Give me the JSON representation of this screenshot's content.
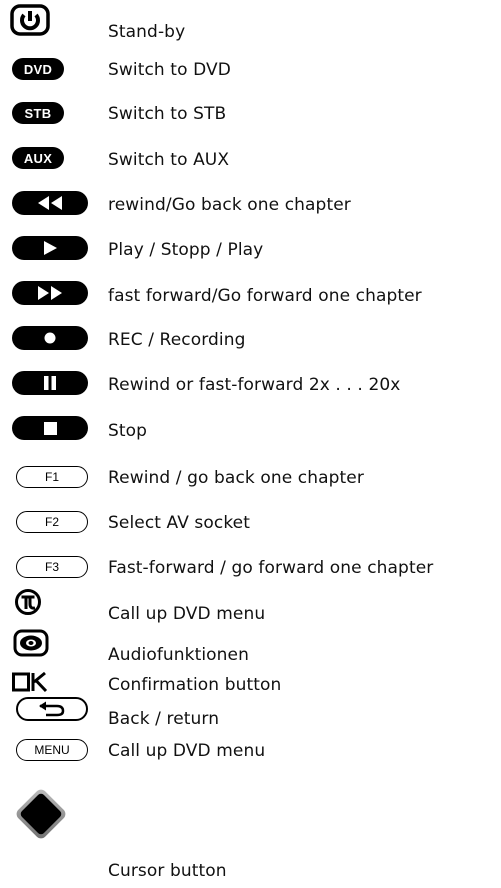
{
  "legend": [
    {
      "icon": "power-icon",
      "label": "Stand-by"
    },
    {
      "icon": "dvd-button-icon",
      "button_text": "DVD",
      "label": "Switch to DVD"
    },
    {
      "icon": "stb-button-icon",
      "button_text": "STB",
      "label": "Switch to STB"
    },
    {
      "icon": "aux-button-icon",
      "button_text": "AUX",
      "label": "Switch to AUX"
    },
    {
      "icon": "rewind-icon",
      "label": "rewind/Go back one chapter"
    },
    {
      "icon": "play-icon",
      "label": "Play / Stopp / Play"
    },
    {
      "icon": "fast-forward-icon",
      "label": "fast forward/Go forward one chapter"
    },
    {
      "icon": "record-icon",
      "label": "REC / Recording"
    },
    {
      "icon": "pause-icon",
      "label": "Rewind or fast-forward 2x . . . 20x"
    },
    {
      "icon": "stop-icon",
      "label": "Stop"
    },
    {
      "icon": "f1-button-icon",
      "button_text": "F1",
      "label": "Rewind / go back one chapter"
    },
    {
      "icon": "f2-button-icon",
      "button_text": "F2",
      "label": "Select AV socket"
    },
    {
      "icon": "f3-button-icon",
      "button_text": "F3",
      "label": "Fast-forward / go forward one chapter"
    },
    {
      "icon": "dvd-menu-logo-icon",
      "label": "Call up DVD menu"
    },
    {
      "icon": "audio-icon",
      "label": "Audiofunktionen"
    },
    {
      "icon": "ok-icon",
      "button_text": "OK",
      "label": "Confirmation button"
    },
    {
      "icon": "back-return-icon",
      "label": "Back / return"
    },
    {
      "icon": "menu-button-icon",
      "button_text": "MENU",
      "label": "Call up DVD menu"
    },
    {
      "icon": "cursor-diamond-icon",
      "label": "Cursor button"
    }
  ]
}
